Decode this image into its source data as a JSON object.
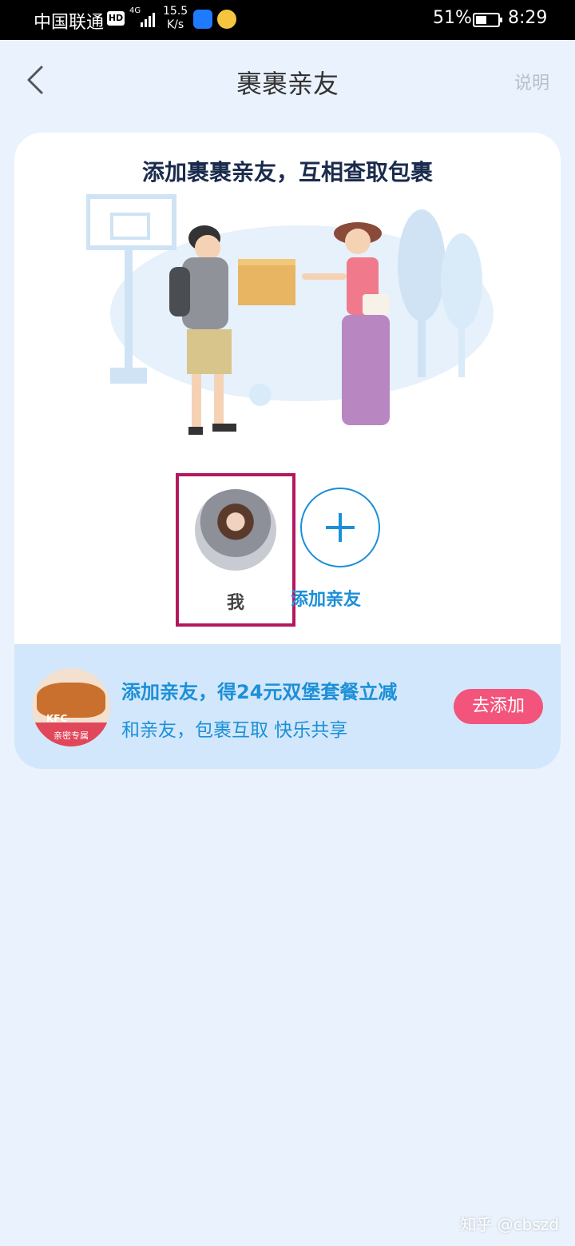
{
  "status_bar": {
    "carrier": "中国联通",
    "hd": "HD",
    "network": "4G",
    "speed_value": "15.5",
    "speed_unit": "K/s",
    "battery": "51%",
    "battery_level": 0.51,
    "time": "8:29"
  },
  "nav": {
    "title": "裹裹亲友",
    "help": "说明",
    "back_icon": "chevron-left-icon"
  },
  "card": {
    "headline": "添加裹裹亲友，互相查取包裹",
    "friends": {
      "me_label": "我",
      "add_label": "添加亲友"
    },
    "promo": {
      "title": "添加亲友，得24元双堡套餐立减",
      "subtitle": "和亲友，包裹互取 快乐共享",
      "badge_brand": "KFC",
      "badge_text": "亲密专属",
      "button": "去添加"
    }
  },
  "watermark": "知乎 @cbszd",
  "colors": {
    "accent_blue": "#1c8fd8",
    "button_pink": "#f2547c",
    "highlight_border": "#b5175e",
    "page_bg": "#eaf2fd"
  }
}
